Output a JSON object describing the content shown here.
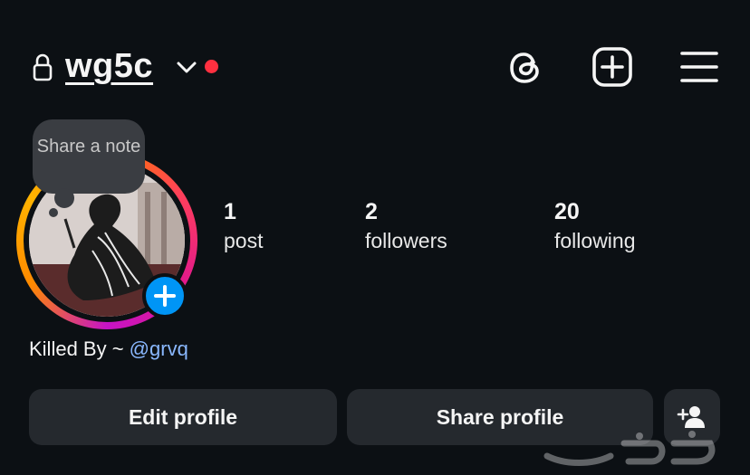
{
  "header": {
    "username": "wg5c",
    "icons": [
      "lock-icon",
      "chevron-down-icon",
      "threads-icon",
      "create-post-icon",
      "menu-icon"
    ],
    "notification_dot_color": "#ff3040"
  },
  "note": {
    "text": "Share a note"
  },
  "stats": [
    {
      "value": "1",
      "label": "post"
    },
    {
      "value": "2",
      "label": "followers"
    },
    {
      "value": "20",
      "label": "following"
    }
  ],
  "bio": {
    "prefix": "Killed By ~ ",
    "mention": "@grvq"
  },
  "buttons": {
    "edit_profile": "Edit profile",
    "share_profile": "Share profile",
    "add_person_icon": "add-person-icon"
  },
  "colors": {
    "background": "#0c1014",
    "button": "#25292e",
    "accent_blue": "#0095f6",
    "mention": "#8ab8ff"
  }
}
